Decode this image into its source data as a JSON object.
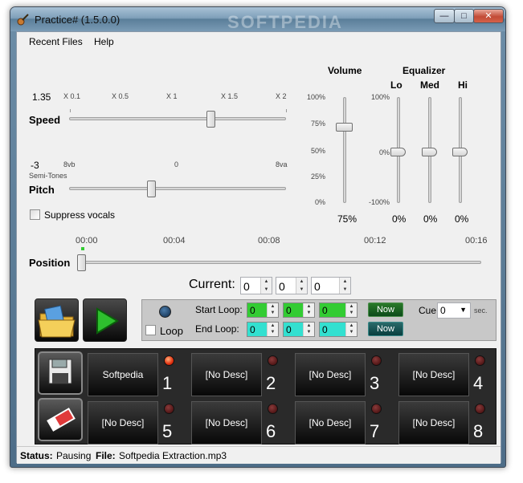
{
  "window": {
    "title": "Practice# (1.5.0.0)",
    "watermark": "SOFTPEDIA",
    "min": "—",
    "max": "□",
    "close": "✕"
  },
  "menu": [
    "Recent Files",
    "Help"
  ],
  "speed": {
    "label": "Speed",
    "value": "1.35",
    "ticks": [
      "X 0.1",
      "X 0.5",
      "X 1",
      "X 1.5",
      "X 2"
    ]
  },
  "pitch": {
    "label": "Pitch",
    "value": "-3",
    "unit": "Semi-Tones",
    "ticks": [
      "8vb",
      "0",
      "8va"
    ]
  },
  "suppress_vocals": "Suppress vocals",
  "volume": {
    "label": "Volume",
    "scale": [
      "100%",
      "75%",
      "50%",
      "25%",
      "0%"
    ],
    "value": "75%"
  },
  "equalizer": {
    "label": "Equalizer",
    "bands": [
      {
        "label": "Lo",
        "value": "0%"
      },
      {
        "label": "Med",
        "value": "0%"
      },
      {
        "label": "Hi",
        "value": "0%"
      }
    ],
    "scale": [
      "100%",
      "0%",
      "-100%"
    ]
  },
  "position": {
    "label": "Position",
    "times": [
      "00:00",
      "00:04",
      "00:08",
      "00:12",
      "00:16"
    ]
  },
  "current": {
    "label": "Current:",
    "fields": [
      "0",
      "0",
      "0"
    ]
  },
  "loop": {
    "checkbox": "Loop",
    "start_label": "Start Loop:",
    "start_values": [
      "0",
      "0",
      "0"
    ],
    "end_label": "End Loop:",
    "end_values": [
      "0",
      "0",
      "0"
    ],
    "now_label": "Now",
    "cue_label": "Cue",
    "cue_value": "0",
    "sec_label": "sec."
  },
  "cues": [
    {
      "label": "Softpedia",
      "num": "1"
    },
    {
      "label": "[No Desc]",
      "num": "2"
    },
    {
      "label": "[No Desc]",
      "num": "3"
    },
    {
      "label": "[No Desc]",
      "num": "4"
    },
    {
      "label": "[No Desc]",
      "num": "5"
    },
    {
      "label": "[No Desc]",
      "num": "6"
    },
    {
      "label": "[No Desc]",
      "num": "7"
    },
    {
      "label": "[No Desc]",
      "num": "8"
    }
  ],
  "status": {
    "status_label": "Status:",
    "status_value": "Pausing",
    "file_label": "File:",
    "file_value": "Softpedia Extraction.mp3"
  }
}
